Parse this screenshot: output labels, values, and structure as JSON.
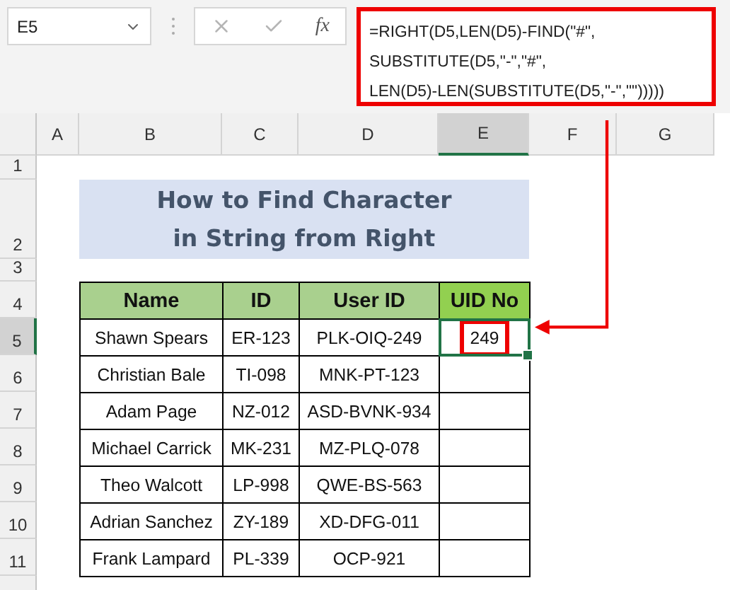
{
  "name_box": {
    "value": "E5"
  },
  "formula_bar": {
    "function_label": "fx",
    "highlighted": true,
    "lines": [
      "=RIGHT(D5,LEN(D5)-FIND(\"#\",",
      "SUBSTITUTE(D5,\"-\",\"#\",",
      "LEN(D5)-LEN(SUBSTITUTE(D5,\"-\",\"\")))))"
    ]
  },
  "columns": [
    {
      "label": "A",
      "selected": false
    },
    {
      "label": "B",
      "selected": false
    },
    {
      "label": "C",
      "selected": false
    },
    {
      "label": "D",
      "selected": false
    },
    {
      "label": "E",
      "selected": true
    },
    {
      "label": "F",
      "selected": false
    },
    {
      "label": "G",
      "selected": false
    }
  ],
  "rows": [
    {
      "label": "1",
      "selected": false
    },
    {
      "label": "2",
      "selected": false
    },
    {
      "label": "3",
      "selected": false
    },
    {
      "label": "4",
      "selected": false
    },
    {
      "label": "5",
      "selected": true
    },
    {
      "label": "6",
      "selected": false
    },
    {
      "label": "7",
      "selected": false
    },
    {
      "label": "8",
      "selected": false
    },
    {
      "label": "9",
      "selected": false
    },
    {
      "label": "10",
      "selected": false
    },
    {
      "label": "11",
      "selected": false
    }
  ],
  "title": {
    "lines": [
      "How to Find Character",
      "in String from Right"
    ]
  },
  "table": {
    "columns": [
      {
        "label": "Name",
        "highlighted": false
      },
      {
        "label": "ID",
        "highlighted": false
      },
      {
        "label": "User ID",
        "highlighted": false
      },
      {
        "label": "UID No",
        "highlighted": true
      }
    ],
    "rows": [
      {
        "name": "Shawn Spears",
        "id": "ER-123",
        "user_id": "PLK-OIQ-249",
        "uid_no": "249",
        "selected": true,
        "highlighted": true
      },
      {
        "name": "Christian Bale",
        "id": "TI-098",
        "user_id": "MNK-PT-123",
        "selected": false
      },
      {
        "name": "Adam Page",
        "id": "NZ-012",
        "user_id": "ASD-BVNK-934",
        "selected": false
      },
      {
        "name": "Michael Carrick",
        "id": "MK-231",
        "user_id": "MZ-PLQ-078",
        "selected": false
      },
      {
        "name": "Theo Walcott",
        "id": "LP-998",
        "user_id": "QWE-BS-563",
        "selected": false
      },
      {
        "name": "Adrian Sanchez",
        "id": "ZY-189",
        "user_id": "XD-DFG-011",
        "selected": false
      },
      {
        "name": "Frank Lampard",
        "id": "PL-339",
        "user_id": "OCP-921",
        "selected": false
      }
    ]
  }
}
